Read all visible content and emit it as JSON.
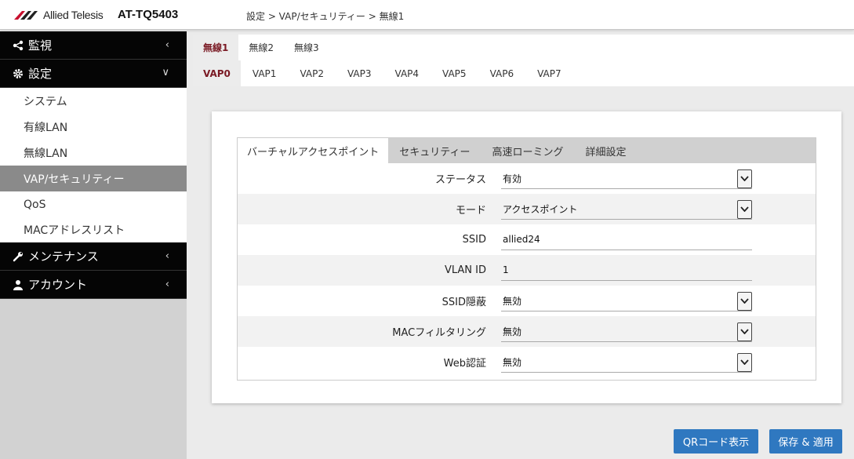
{
  "header": {
    "logo_text": "Allied Telesis",
    "model": "AT-TQ5403",
    "breadcrumb": "設定 > VAP/セキュリティー > 無線1"
  },
  "sidebar": {
    "groups": [
      {
        "label": "監視",
        "icon": "share-icon",
        "expanded": false
      },
      {
        "label": "設定",
        "icon": "gear-icon",
        "expanded": true
      },
      {
        "label": "メンテナンス",
        "icon": "wrench-icon",
        "expanded": false
      },
      {
        "label": "アカウント",
        "icon": "user-icon",
        "expanded": false
      }
    ],
    "items": [
      "システム",
      "有線LAN",
      "無線LAN",
      "VAP/セキュリティー",
      "QoS",
      "MACアドレスリスト"
    ],
    "active_item": "VAP/セキュリティー"
  },
  "radio_tabs": [
    "無線1",
    "無線2",
    "無線3"
  ],
  "vap_tabs": [
    "VAP0",
    "VAP1",
    "VAP2",
    "VAP3",
    "VAP4",
    "VAP5",
    "VAP6",
    "VAP7"
  ],
  "subtabs": [
    "バーチャルアクセスポイント",
    "セキュリティー",
    "高速ローミング",
    "詳細設定"
  ],
  "form": {
    "status": {
      "label": "ステータス",
      "value": "有効"
    },
    "mode": {
      "label": "モード",
      "value": "アクセスポイント"
    },
    "ssid": {
      "label": "SSID",
      "value": "allied24"
    },
    "vlan": {
      "label": "VLAN ID",
      "value": "1"
    },
    "ssid_hide": {
      "label": "SSID隠蔽",
      "value": "無効"
    },
    "mac_filter": {
      "label": "MACフィルタリング",
      "value": "無効"
    },
    "web_auth": {
      "label": "Web認証",
      "value": "無効"
    }
  },
  "buttons": {
    "qr": "QRコード表示",
    "save": "保存 & 適用"
  },
  "colors": {
    "accent": "#7a1a24",
    "button": "#2f78c0",
    "nav_bg": "#050505",
    "active_item_bg": "#8a8a8a"
  }
}
